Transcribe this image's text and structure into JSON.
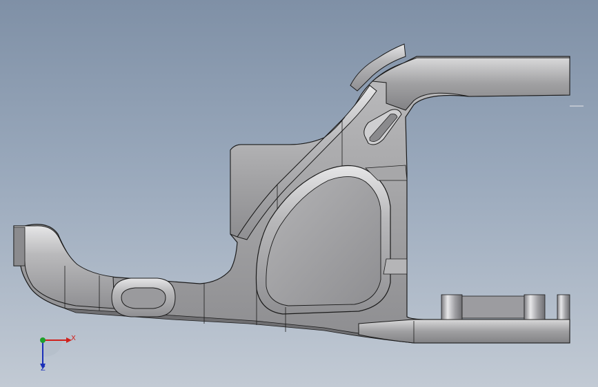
{
  "viewport": {
    "name": "3d-cad-viewport",
    "part": "control-arm-bracket"
  },
  "triad": {
    "x_label": "X",
    "z_label": "Z",
    "x_color": "#d0201b",
    "y_color": "#1ea02a",
    "z_color": "#1a2fb8"
  },
  "colors": {
    "background_top": "#7f90a6",
    "background_bottom": "#c2cad4",
    "part_face": "#a7a7a9",
    "part_edge": "#1a1a1a",
    "highlight": "#f2f2f2"
  }
}
